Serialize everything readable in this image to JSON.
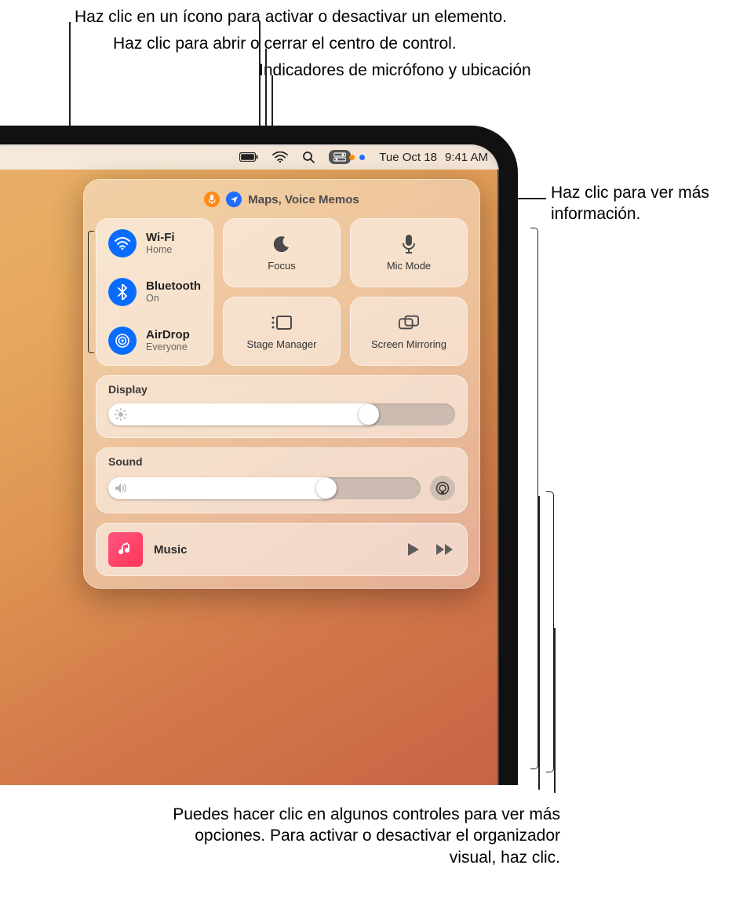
{
  "callouts": {
    "top1": "Haz clic en un ícono para activar o desactivar un elemento.",
    "top2": "Haz clic para abrir o cerrar el centro de control.",
    "top3": "Indicadores de micrófono y ubicación",
    "right1": "Haz clic para ver más información.",
    "bottom": "Puedes hacer clic en algunos controles para ver más opciones. Para activar o desactivar el organizador visual, haz clic."
  },
  "menubar": {
    "date": "Tue Oct 18",
    "time": "9:41 AM"
  },
  "sensors": {
    "text": "Maps, Voice Memos"
  },
  "connectivity": {
    "wifi": {
      "title": "Wi-Fi",
      "sub": "Home"
    },
    "bluetooth": {
      "title": "Bluetooth",
      "sub": "On"
    },
    "airdrop": {
      "title": "AirDrop",
      "sub": "Everyone"
    }
  },
  "tiles": {
    "focus": "Focus",
    "micmode": "Mic Mode",
    "stage": "Stage Manager",
    "screen": "Screen Mirroring"
  },
  "display": {
    "label": "Display",
    "value_pct": 78
  },
  "sound": {
    "label": "Sound",
    "value_pct": 73
  },
  "music": {
    "title": "Music"
  }
}
